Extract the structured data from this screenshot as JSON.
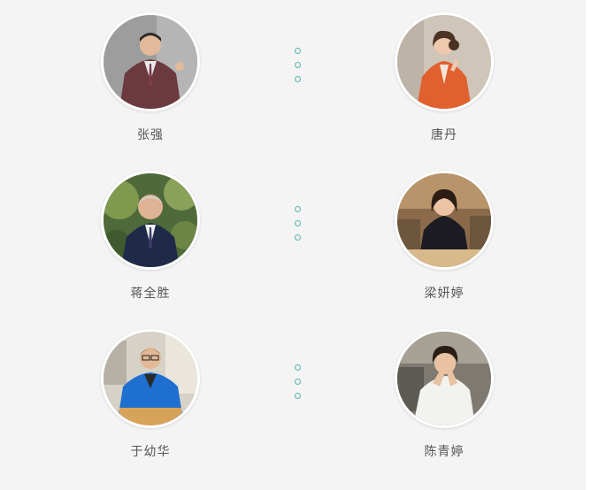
{
  "players": [
    {
      "left": {
        "name": "张强",
        "avatar_icon": "portrait-man-maroon-suit"
      },
      "right": {
        "name": "唐丹",
        "avatar_icon": "portrait-woman-orange-jacket"
      }
    },
    {
      "left": {
        "name": "蒋全胜",
        "avatar_icon": "portrait-man-navy-suit-outdoors"
      },
      "right": {
        "name": "梁妍婷",
        "avatar_icon": "portrait-woman-at-board"
      }
    },
    {
      "left": {
        "name": "于幼华",
        "avatar_icon": "portrait-man-blue-jacket-at-board"
      },
      "right": {
        "name": "陈青婷",
        "avatar_icon": "portrait-woman-thinking"
      }
    }
  ],
  "colors": {
    "panel_background": "#f4f4f4",
    "name_text": "#555555",
    "divider_dot": "#5ab4b0",
    "avatar_border": "#ffffff"
  }
}
